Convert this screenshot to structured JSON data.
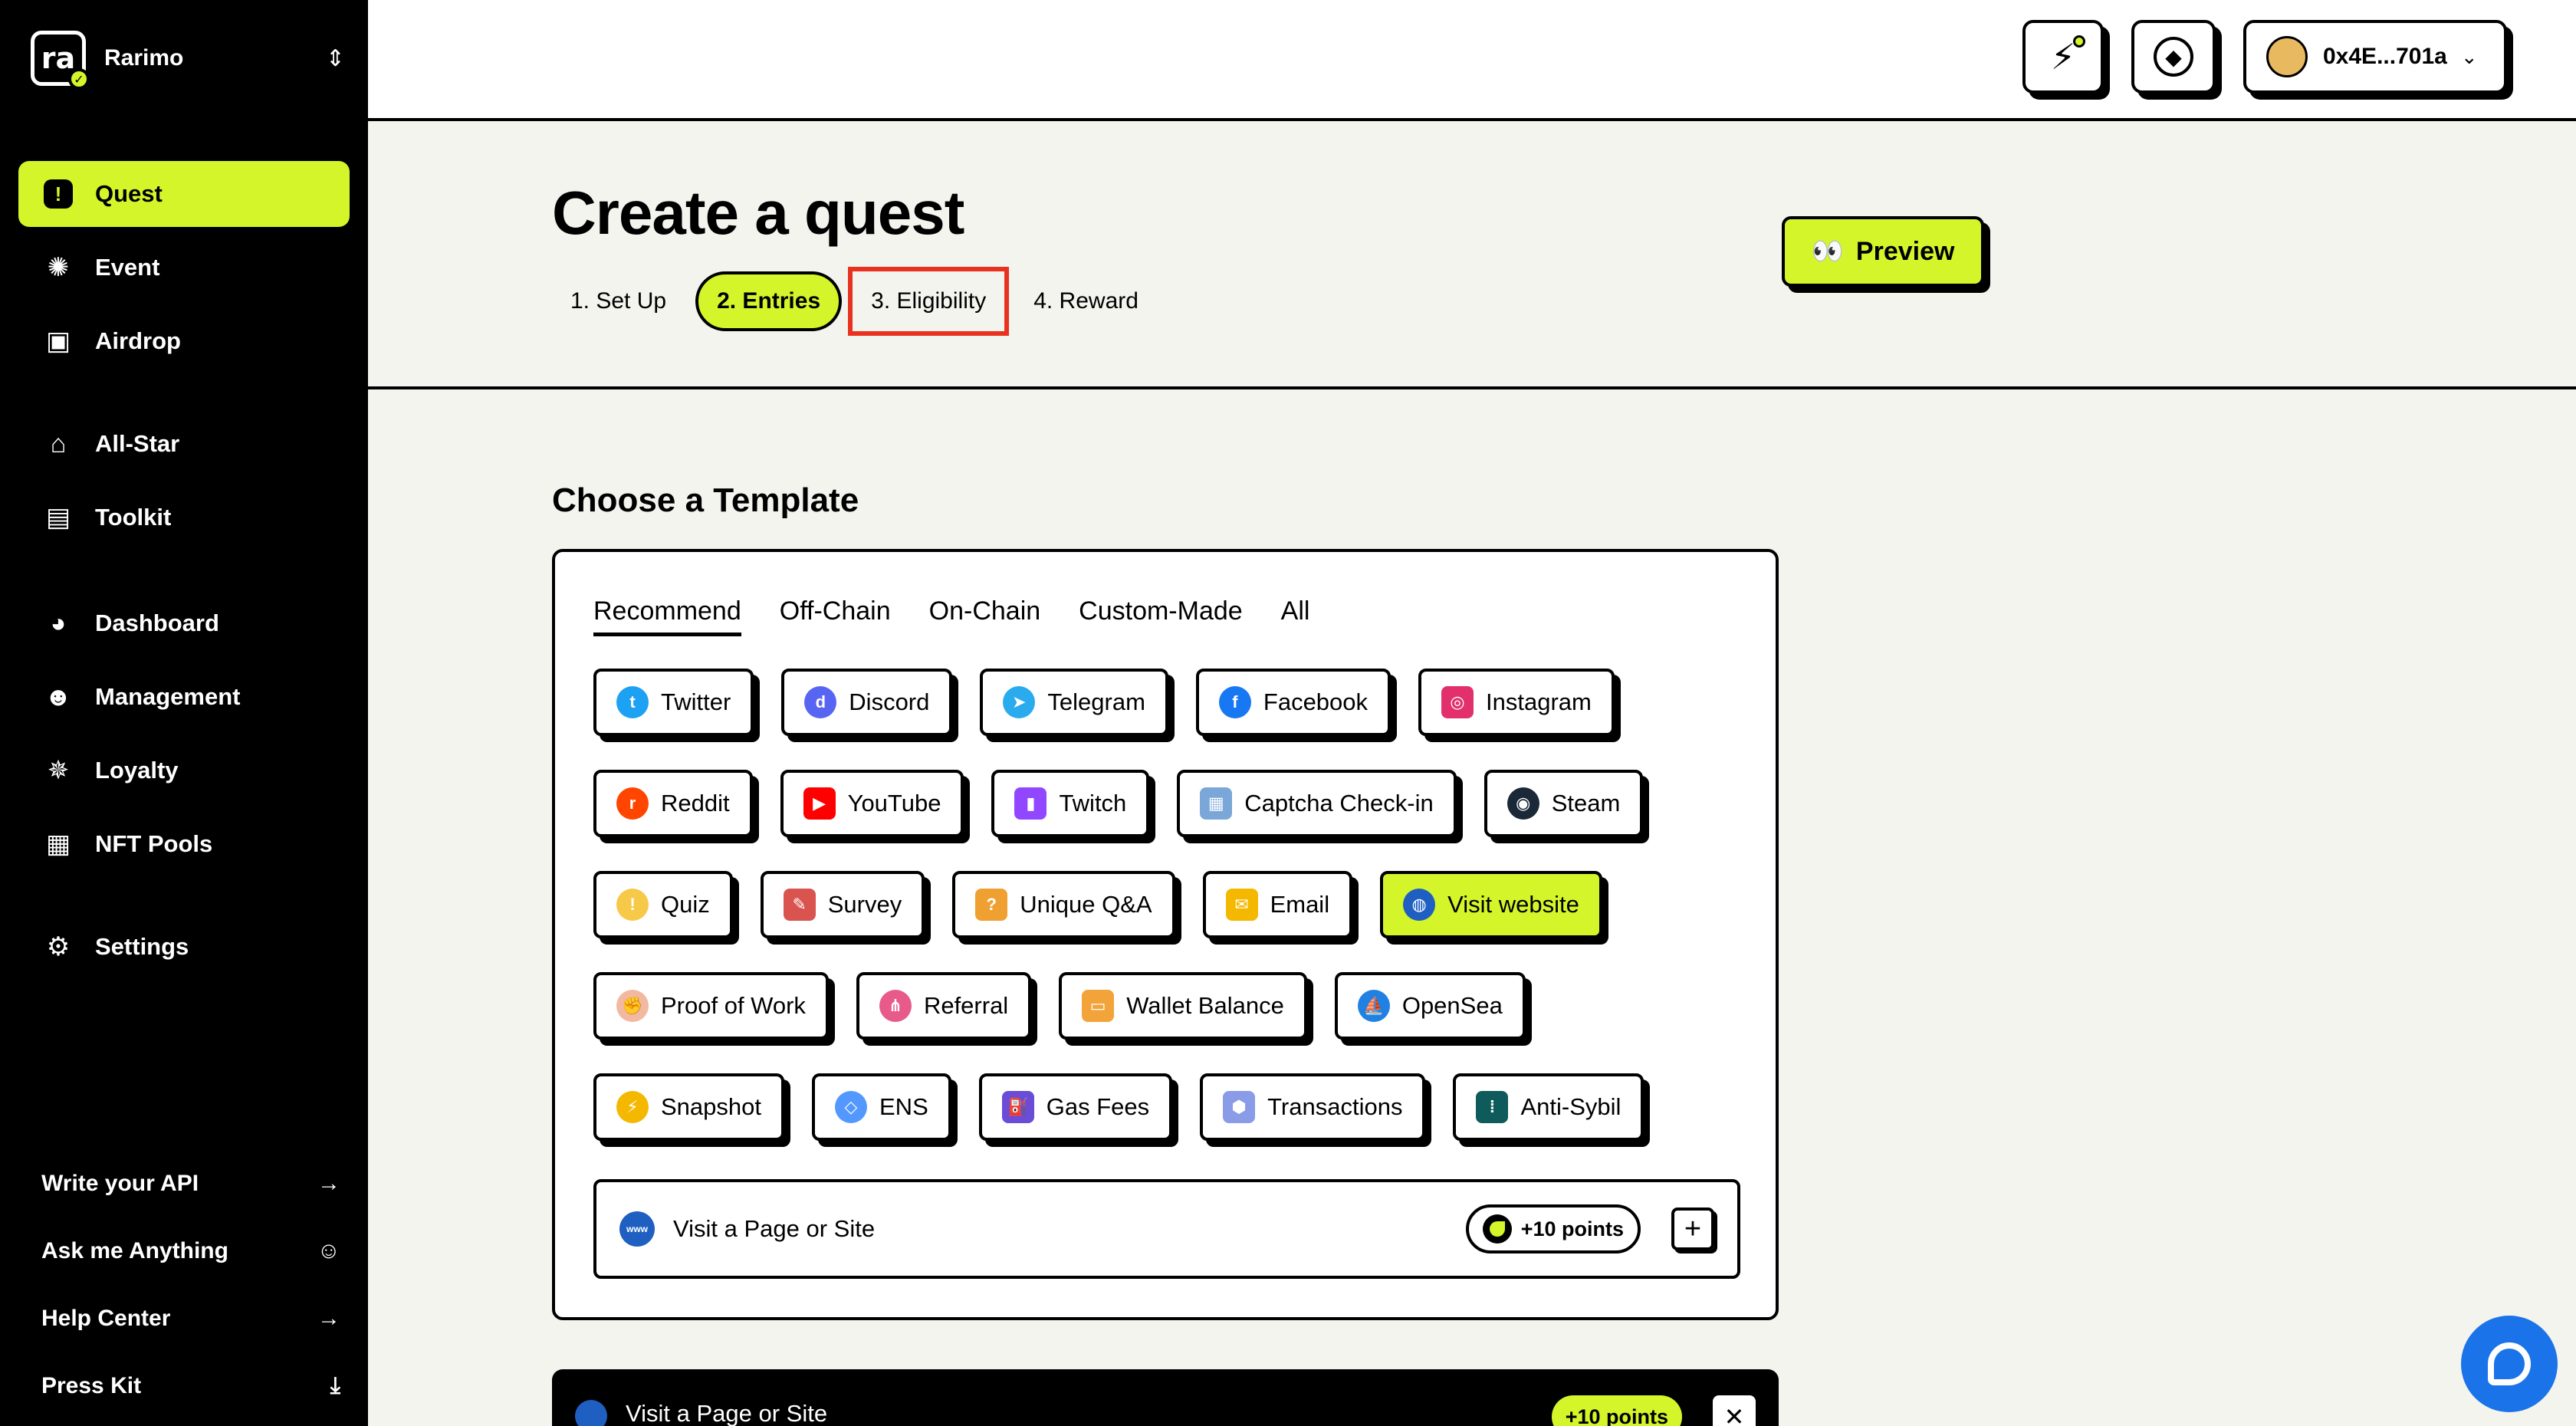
{
  "brand": {
    "name": "Rarimo",
    "logo_text": "ra"
  },
  "sidebar": {
    "group1": [
      {
        "label": "Quest",
        "icon": "exclamation-icon",
        "active": true
      },
      {
        "label": "Event",
        "icon": "party-icon"
      },
      {
        "label": "Airdrop",
        "icon": "gift-icon"
      }
    ],
    "group2": [
      {
        "label": "All-Star",
        "icon": "star-house-icon"
      },
      {
        "label": "Toolkit",
        "icon": "toolbox-icon"
      }
    ],
    "group3": [
      {
        "label": "Dashboard",
        "icon": "pie-chart-icon"
      },
      {
        "label": "Management",
        "icon": "user-gear-icon"
      },
      {
        "label": "Loyalty",
        "icon": "sparkle-icon"
      },
      {
        "label": "NFT Pools",
        "icon": "nft-icon"
      }
    ],
    "group4": [
      {
        "label": "Settings",
        "icon": "gear-icon"
      }
    ],
    "bottom": [
      {
        "label": "Write your API",
        "icon": "arrow-right-icon"
      },
      {
        "label": "Ask me Anything",
        "icon": "astronaut-icon"
      },
      {
        "label": "Help Center",
        "icon": "arrow-right-icon"
      },
      {
        "label": "Press Kit",
        "icon": "download-icon"
      }
    ]
  },
  "topbar": {
    "wallet_address": "0x4E...701a"
  },
  "header": {
    "title": "Create a quest",
    "steps": [
      "1. Set Up",
      "2. Entries",
      "3. Eligibility",
      "4. Reward"
    ],
    "preview_label": "Preview"
  },
  "main": {
    "section_title": "Choose a Template",
    "tabs": [
      "Recommend",
      "Off-Chain",
      "On-Chain",
      "Custom-Made",
      "All"
    ],
    "rows": [
      [
        "Twitter",
        "Discord",
        "Telegram",
        "Facebook",
        "Instagram"
      ],
      [
        "Reddit",
        "YouTube",
        "Twitch",
        "Captcha Check-in",
        "Steam"
      ],
      [
        "Quiz",
        "Survey",
        "Unique Q&A",
        "Email",
        "Visit website"
      ],
      [
        "Proof of Work",
        "Referral",
        "Wallet Balance",
        "OpenSea"
      ],
      [
        "Snapshot",
        "ENS",
        "Gas Fees",
        "Transactions",
        "Anti-Sybil"
      ]
    ],
    "entry": {
      "label": "Visit a Page or Site",
      "points": "+10 points"
    },
    "dark_entry": {
      "label": "Visit a Page or Site",
      "points": "+10 points"
    }
  },
  "colors": {
    "accent": "#d4f52a",
    "highlight": "#e8321f"
  }
}
